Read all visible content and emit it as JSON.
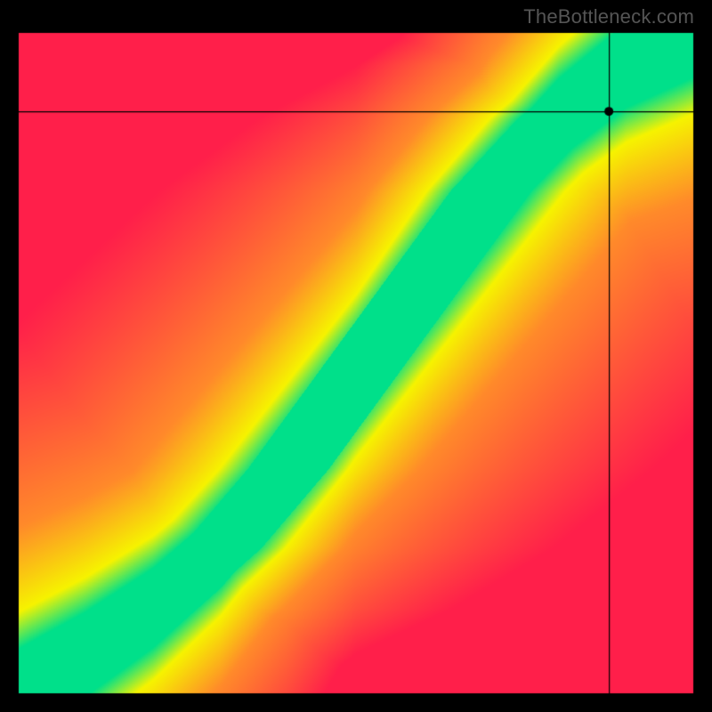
{
  "watermark": "TheBottleneck.com",
  "chart_data": {
    "type": "heatmap",
    "title": "",
    "xlabel": "",
    "ylabel": "",
    "xlim": [
      0,
      100
    ],
    "ylim": [
      0,
      100
    ],
    "colormap": "red-yellow-green",
    "description": "Continuous 2D heatmap where an oblique S-shaped ridge running from lower-left to upper-right is green (optimal / no bottleneck). Surrounding band is yellow, fading to orange then red toward the top-left and bottom-right corners (heavy bottleneck).",
    "ridge_control_points": [
      {
        "x": 0,
        "y": 0
      },
      {
        "x": 10,
        "y": 6
      },
      {
        "x": 20,
        "y": 13
      },
      {
        "x": 30,
        "y": 22
      },
      {
        "x": 40,
        "y": 34
      },
      {
        "x": 50,
        "y": 48
      },
      {
        "x": 60,
        "y": 62
      },
      {
        "x": 70,
        "y": 76
      },
      {
        "x": 80,
        "y": 87
      },
      {
        "x": 90,
        "y": 95
      },
      {
        "x": 100,
        "y": 100
      }
    ],
    "ridge_half_width": 5,
    "crosshair": {
      "x": 87.5,
      "y": 88
    },
    "marker": {
      "x": 87.5,
      "y": 88,
      "label": ""
    },
    "color_stops": {
      "green": "#00e08a",
      "yellow": "#f6f300",
      "orange": "#ff8a2a",
      "red": "#ff1f4a"
    }
  }
}
